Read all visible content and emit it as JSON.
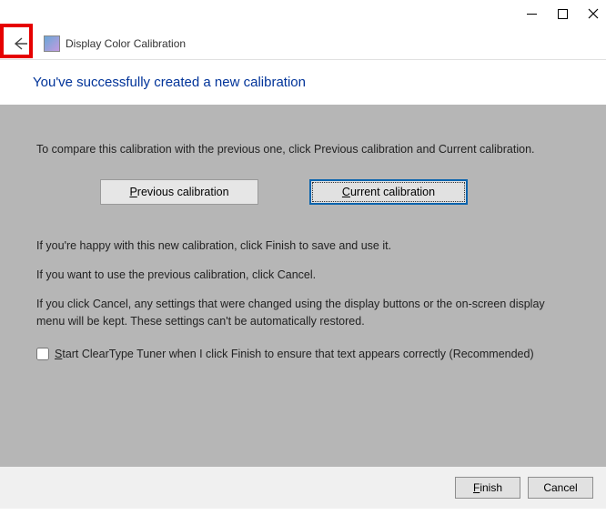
{
  "window": {
    "title": "Display Color Calibration"
  },
  "heading": "You've successfully created a new calibration",
  "body": {
    "compare_text": "To compare this calibration with the previous one, click Previous calibration and Current calibration.",
    "previous_btn": "Previous calibration",
    "current_btn": "Current calibration",
    "happy_text": "If you're happy with this new calibration, click Finish to save and use it.",
    "previous_text": "If you want to use the previous calibration, click Cancel.",
    "cancel_text": "If you click Cancel, any settings that were changed using the display buttons or the on-screen display menu will be kept. These settings can't be automatically restored.",
    "cleartype_label_pre": "S",
    "cleartype_label_rest": "tart ClearType Tuner when I click Finish to ensure that text appears correctly (Recommended)"
  },
  "footer": {
    "finish": "Finish",
    "cancel": "Cancel"
  }
}
